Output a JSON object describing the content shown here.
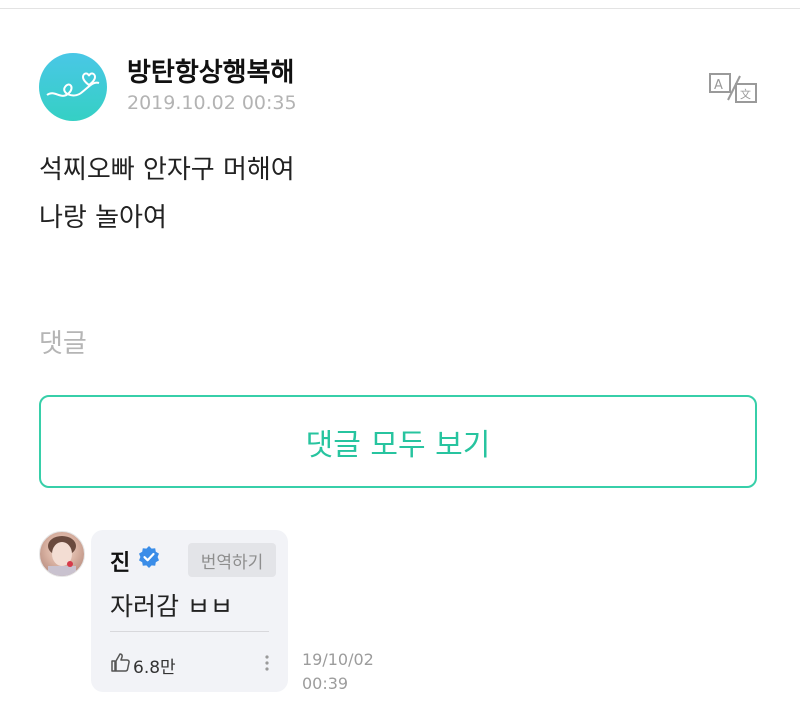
{
  "post": {
    "author": "방탄항상행복해",
    "date": "2019.10.02 00:35",
    "lines": [
      "석찌오빠 안자구 머해여",
      "나랑 놀아여"
    ],
    "translate_icon": "translate-icon"
  },
  "comments": {
    "label": "댓글",
    "view_all_label": "댓글 모두 보기",
    "items": [
      {
        "name": "진",
        "verified": true,
        "translate_label": "번역하기",
        "text": "자러감 ㅂㅂ",
        "likes": "6.8만",
        "date_line1": "19/10/02",
        "date_line2": "00:39"
      }
    ]
  },
  "colors": {
    "accent": "#37cfa9",
    "verified": "#3b8de8",
    "bubble": "#f2f3f7"
  }
}
